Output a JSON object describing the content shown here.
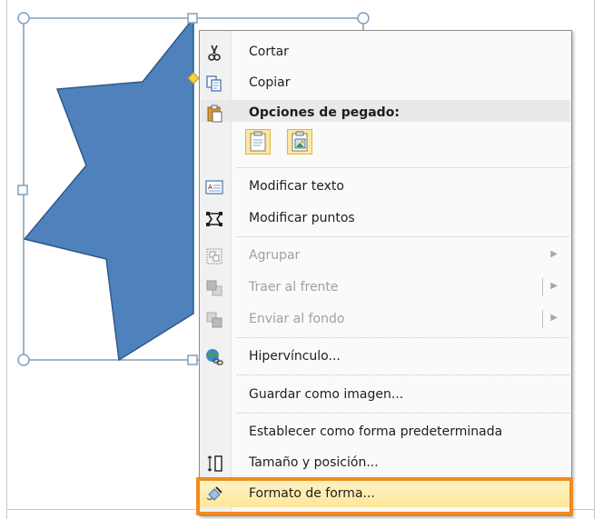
{
  "context_menu": {
    "cut": "Cortar",
    "copy": "Copiar",
    "paste_options_header": "Opciones de pegado:",
    "edit_text": "Modificar texto",
    "edit_points": "Modificar puntos",
    "group": "Agrupar",
    "bring_to_front": "Traer al frente",
    "send_to_back": "Enviar al fondo",
    "hyperlink": "Hipervínculo...",
    "save_as_image": "Guardar como imagen...",
    "set_as_default_shape": "Establecer como forma predeterminada",
    "size_and_position": "Tamaño y posición...",
    "format_shape": "Formato de forma..."
  },
  "colors": {
    "shape_fill": "#4f81bd",
    "shape_stroke": "#2c5a8a",
    "selection_line": "#466b8e",
    "callout": "#f28a1f",
    "highlight": "#fde79a"
  },
  "icons": [
    "scissors-icon",
    "copy-icon",
    "paste-icon",
    "keep-formatting-paste-icon",
    "picture-paste-icon",
    "edit-text-icon",
    "edit-points-icon",
    "group-icon",
    "bring-to-front-icon",
    "send-to-back-icon",
    "hyperlink-icon",
    "size-position-icon",
    "format-shape-icon"
  ]
}
